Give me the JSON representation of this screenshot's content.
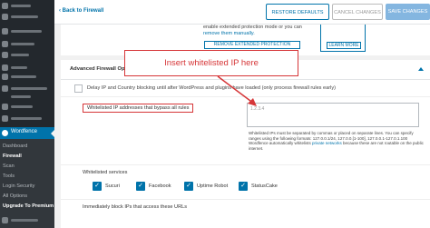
{
  "sidebar": {
    "wordfence_label": "Wordfence",
    "submenu": [
      "Dashboard",
      "Firewall",
      "Scan",
      "Tools",
      "Login Security",
      "All Options",
      "Upgrade To Premium"
    ],
    "active_submenu": "Firewall"
  },
  "topbar": {
    "back_link": "Back to Firewall",
    "restore_defaults": "RESTORE DEFAULTS",
    "cancel_changes": "CANCEL CHANGES",
    "save_changes": "SAVE CHANGES"
  },
  "top_card": {
    "text_line1": "enable extended protection mode or you can",
    "text_link": "remove them manually.",
    "remove_button": "REMOVE EXTENDED PROTECTION",
    "learn_more": "LEARN MORE"
  },
  "section": {
    "title": "Advanced Firewall Optio"
  },
  "delay_option": {
    "label": "Delay IP and Country blocking until after WordPress and plugins have loaded (only process firewall rules early)"
  },
  "whitelist": {
    "label": "Whitelisted IP addresses that bypass all rules",
    "placeholder": "1.2.3.4",
    "help_text": "Whitelisted IPs must be separated by commas or placed on separate lines. You can specify ranges using the following formats: 127.0.0.1/24, 127.0.0.[1-100], 127.0.0.1-127.0.1.100 Wordfence automatically whitelists",
    "help_link": "private networks",
    "help_tail": "because these are not routable on the public internet."
  },
  "services": {
    "label": "Whitelisted services",
    "items": [
      {
        "label": "Sucuri"
      },
      {
        "label": "Facebook"
      },
      {
        "label": "Uptime Robot"
      },
      {
        "label": "StatusCake"
      }
    ]
  },
  "block_option": {
    "label": "Immediately block IPs that access these URLs"
  },
  "annotation": {
    "text": "Insert whitelisted IP here",
    "color": "#d63638"
  },
  "colors": {
    "accent": "#0073aa",
    "sidebar_bg": "#23282d",
    "submenu_bg": "#32373c"
  }
}
